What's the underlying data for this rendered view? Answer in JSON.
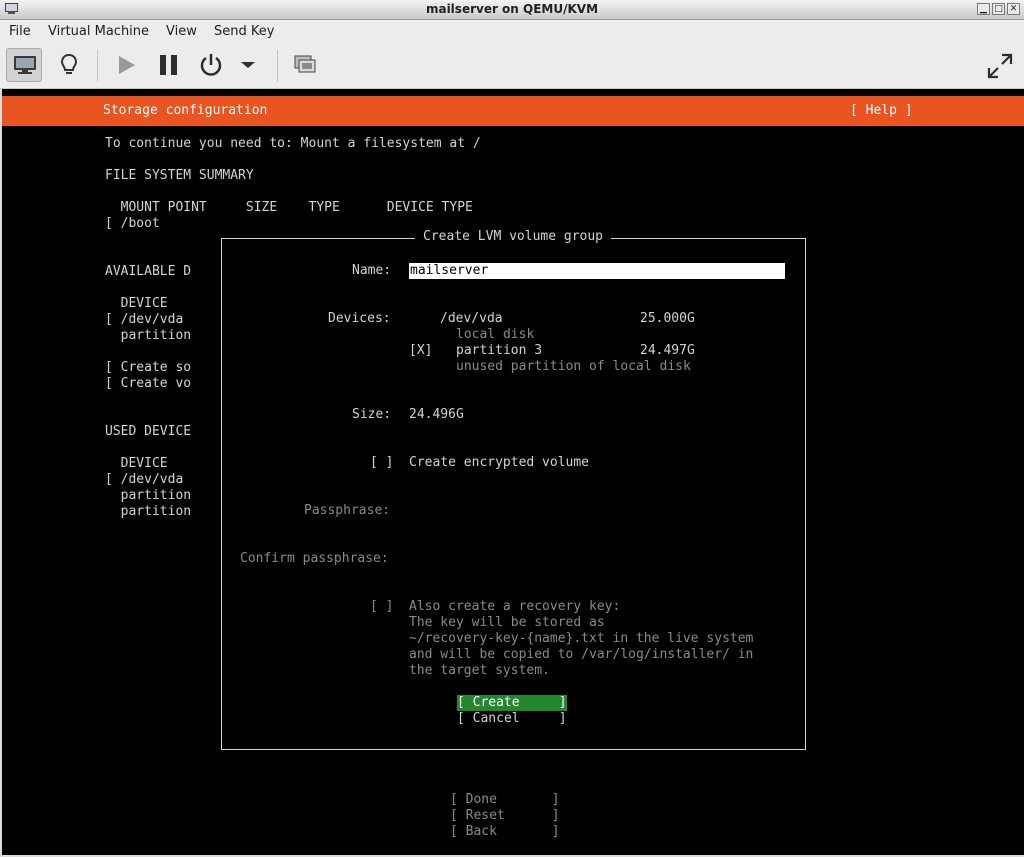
{
  "window": {
    "title": "mailserver on QEMU/KVM",
    "minimize": "▁",
    "maximize": "□",
    "close": "✕"
  },
  "menu": [
    "File",
    "Virtual Machine",
    "View",
    "Send Key"
  ],
  "toolbar": {
    "icons": [
      "console-monitor-icon",
      "lightbulb-details-icon",
      "play-icon",
      "pause-icon",
      "power-icon",
      "dropdown-arrow-icon",
      "snapshots-icon",
      "fullscreen-icon"
    ]
  },
  "installer": {
    "header_title": "Storage configuration",
    "help": "[ Help ]",
    "notice": "To continue you need to: Mount a filesystem at /",
    "fs_summary_heading": "FILE SYSTEM SUMMARY",
    "fs_columns": "  MOUNT POINT     SIZE    TYPE      DEVICE TYPE",
    "fs_row": "[ /boot",
    "available_heading": "AVAILABLE D",
    "available_device_header": "  DEVICE",
    "available_device_row": "[ /dev/vda",
    "available_partition_row": "  partition",
    "create_software_raid": "[ Create so",
    "create_volume_group": "[ Create vo",
    "used_heading": "USED DEVICE",
    "used_device_header": "  DEVICE",
    "used_device_row": "[ /dev/vda",
    "used_partition_1": "  partition",
    "used_partition_2": "  partition",
    "done": "[ Done       ]",
    "reset": "[ Reset      ]",
    "back": "[ Back       ]"
  },
  "dialog": {
    "title": "Create LVM volume group",
    "name_label": "Name:",
    "name_value": "mailserver",
    "devices_label": "Devices:",
    "device_name": "/dev/vda",
    "device_size": "25.000G",
    "device_desc": "local disk",
    "partition_checkbox": "[X]",
    "partition_name": "partition 3",
    "partition_size": "24.497G",
    "partition_desc": "unused partition of local disk",
    "size_label": "Size:",
    "size_value": "24.496G",
    "encrypt_checkbox": "[ ]",
    "encrypt_label": "Create encrypted volume",
    "passphrase_label": "Passphrase:",
    "confirm_passphrase_label": "Confirm passphrase:",
    "recovery_checkbox": "[ ]",
    "recovery_line1": "Also create a recovery key:",
    "recovery_line2": "The key will be stored as",
    "recovery_line3": "~/recovery-key-{name}.txt in the live system",
    "recovery_line4": "and will be copied to /var/log/installer/ in",
    "recovery_line5": "the target system.",
    "create_button": "[ Create     ]",
    "cancel_button": "[ Cancel     ]"
  },
  "colors": {
    "header_orange": "#e95420",
    "selected_green": "#23872c",
    "console_bg": "#000000"
  }
}
